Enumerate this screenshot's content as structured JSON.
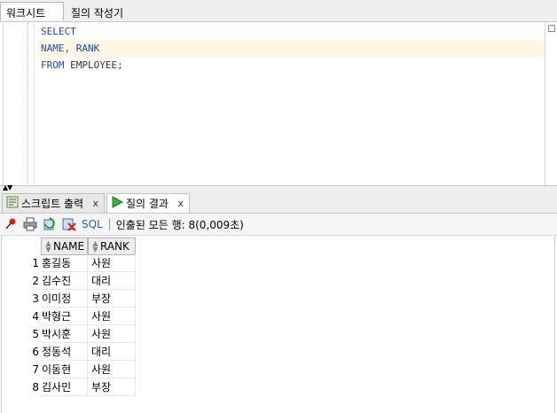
{
  "tabs": {
    "worksheet": "워크시트",
    "query_builder": "질의 작성기"
  },
  "editor": {
    "lines": [
      {
        "text": "SELECT",
        "kind": "keyword"
      },
      {
        "text": "NAME, RANK",
        "kind": "keyword"
      },
      {
        "text": "FROM EMPLOYEE;",
        "kind": "mixed",
        "kw": "FROM",
        "rest": " EMPLOYEE;"
      }
    ]
  },
  "bottom_tabs": [
    {
      "label": "스크립트 출력",
      "close": "x",
      "icon": "script-output-icon"
    },
    {
      "label": "질의 결과",
      "close": "x",
      "icon": "run-triangle-icon"
    }
  ],
  "toolbar": {
    "sql_label": "SQL",
    "separator": "|",
    "status": "인출된 모든 행: 8(0,009초)",
    "icons": [
      "pin-icon",
      "print-icon",
      "refresh-icon",
      "delete-icon"
    ]
  },
  "grid": {
    "columns": [
      "NAME",
      "RANK"
    ],
    "rows": [
      {
        "n": "1",
        "name": "홍길동",
        "rank": "사원"
      },
      {
        "n": "2",
        "name": "김수진",
        "rank": "대리"
      },
      {
        "n": "3",
        "name": "이미정",
        "rank": "부장"
      },
      {
        "n": "4",
        "name": "박형근",
        "rank": "사원"
      },
      {
        "n": "5",
        "name": "박시훈",
        "rank": "사원"
      },
      {
        "n": "6",
        "name": "정동석",
        "rank": "대리"
      },
      {
        "n": "7",
        "name": "이동현",
        "rank": "사원"
      },
      {
        "n": "8",
        "name": "김사민",
        "rank": "부장"
      }
    ]
  },
  "colors": {
    "keyword": "#1c49b8",
    "highlight_line": "#fdf6e3"
  }
}
